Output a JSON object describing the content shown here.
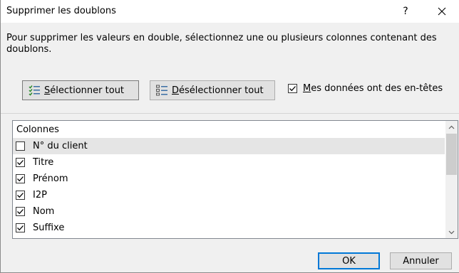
{
  "dialog": {
    "title": "Supprimer les doublons",
    "help_label": "?",
    "close_icon": "close-icon"
  },
  "description": "Pour supprimer les valeurs en double, sélectionnez une ou plusieurs colonnes contenant des doublons.",
  "toolbar": {
    "select_all": {
      "accel": "S",
      "rest": "électionner tout",
      "icon": "select-all-icon"
    },
    "deselect_all": {
      "accel": "D",
      "rest": "ésélectionner tout",
      "icon": "deselect-all-icon"
    },
    "headers_checkbox": {
      "accel": "M",
      "rest": "es données ont des en-têtes",
      "checked": true
    }
  },
  "columns_list": {
    "header": "Colonnes",
    "items": [
      {
        "label": "N° du client",
        "checked": false
      },
      {
        "label": "Titre",
        "checked": true
      },
      {
        "label": "Prénom",
        "checked": true
      },
      {
        "label": "I2P",
        "checked": true
      },
      {
        "label": "Nom",
        "checked": true
      },
      {
        "label": "Suffixe",
        "checked": true
      }
    ]
  },
  "footer": {
    "ok": "OK",
    "cancel": "Annuler"
  },
  "colors": {
    "accent": "#0078d7",
    "selected_row": "#e5e5e5"
  }
}
